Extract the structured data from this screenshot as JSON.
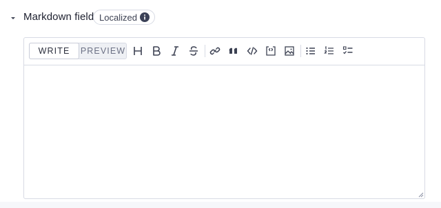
{
  "field": {
    "label": "Markdown field",
    "badge": "Localized",
    "collapse_icon": "caret-down-icon",
    "badge_icon": "info-icon"
  },
  "editor": {
    "tabs": [
      {
        "label": "WRITE",
        "selected": true
      },
      {
        "label": "PREVIEW",
        "selected": false
      }
    ],
    "toolbar_icons": [
      "heading-icon",
      "bold-icon",
      "italic-icon",
      "strikethrough-icon",
      "link-icon",
      "quote-icon",
      "code-icon",
      "code-block-icon",
      "image-icon",
      "bulleted-list-icon",
      "numbered-list-icon",
      "checklist-icon"
    ],
    "content": ""
  },
  "colors": {
    "border": "#d7dae4",
    "text": "#1c1f2e",
    "icon": "#3c4152",
    "info_badge": "#3b4157"
  }
}
